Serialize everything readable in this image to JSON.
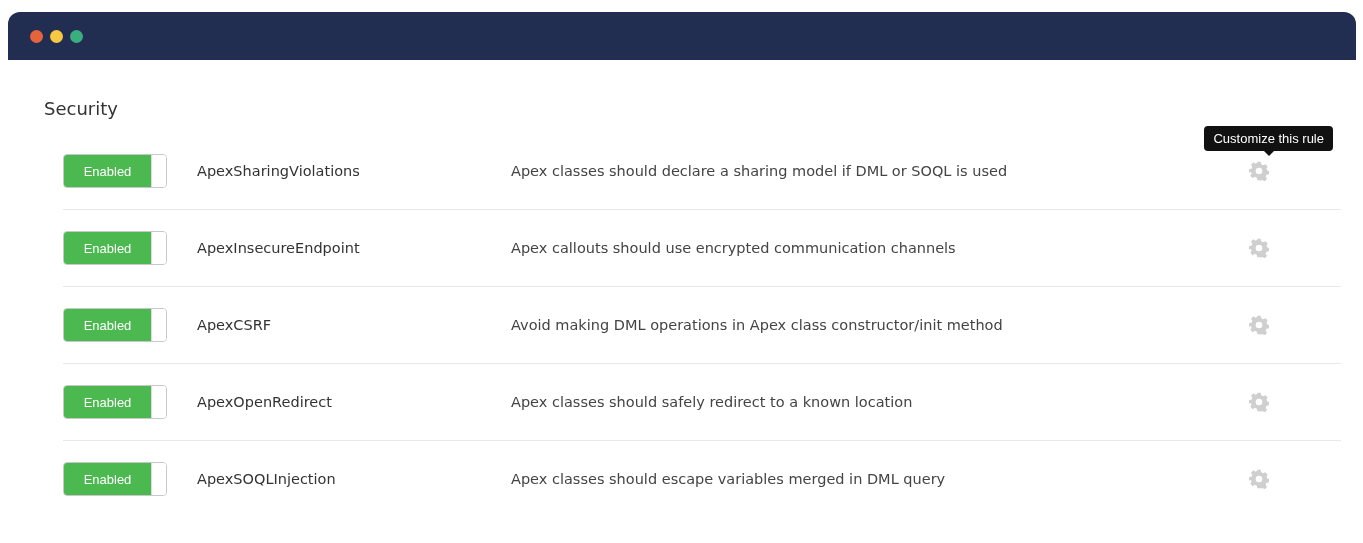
{
  "section": {
    "title": "Security"
  },
  "rules": [
    {
      "on": true,
      "toggle_label": "Enabled",
      "name": "ApexSharingViolations",
      "description": "Apex classes should declare a sharing model if DML or SOQL is used",
      "tooltip": "Customize this rule"
    },
    {
      "on": true,
      "toggle_label": "Enabled",
      "name": "ApexInsecureEndpoint",
      "description": "Apex callouts should use encrypted communication channels"
    },
    {
      "on": true,
      "toggle_label": "Enabled",
      "name": "ApexCSRF",
      "description": "Avoid making DML operations in Apex class constructor/init method"
    },
    {
      "on": true,
      "toggle_label": "Enabled",
      "name": "ApexOpenRedirect",
      "description": "Apex classes should safely redirect to a known location"
    },
    {
      "on": true,
      "toggle_label": "Enabled",
      "name": "ApexSOQLInjection",
      "description": "Apex classes should escape variables merged in DML query"
    }
  ]
}
